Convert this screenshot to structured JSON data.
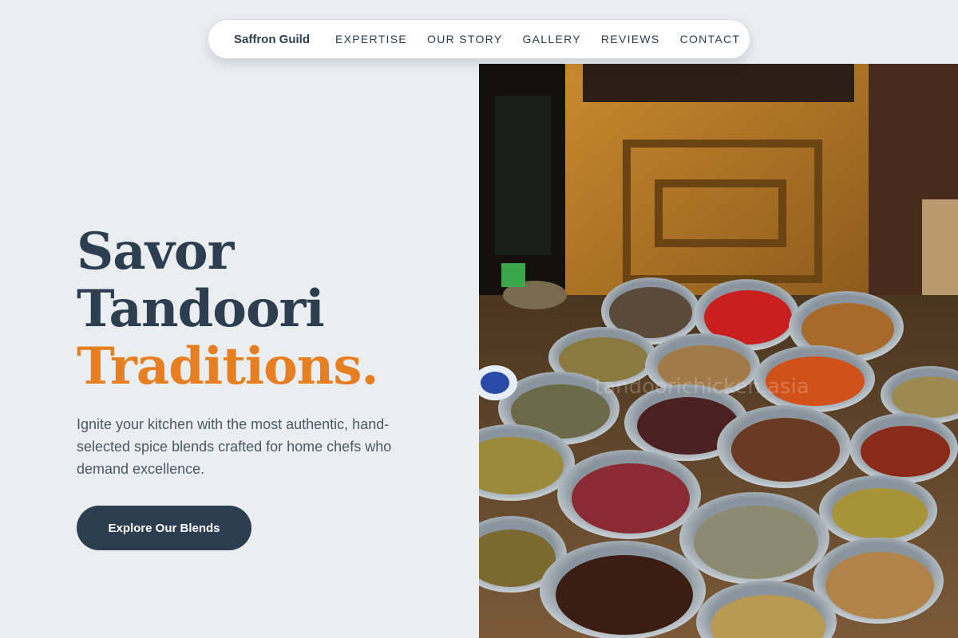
{
  "nav": {
    "brand": "Saffron Guild",
    "links": [
      {
        "label": "EXPERTISE"
      },
      {
        "label": "OUR STORY"
      },
      {
        "label": "GALLERY"
      },
      {
        "label": "REVIEWS"
      },
      {
        "label": "CONTACT"
      }
    ]
  },
  "hero": {
    "title_line1": "Savor",
    "title_line2": "Tandoori",
    "title_line3": "Traditions.",
    "description": "Ignite your kitchen with the most authentic, hand-selected spice blends crafted for home chefs who demand excellence.",
    "cta_label": "Explore Our Blends"
  },
  "photo": {
    "watermark": "tandoorichicken.asia"
  },
  "colors": {
    "primary": "#2c3e50",
    "accent": "#e67e22",
    "background": "#ebeef0"
  }
}
